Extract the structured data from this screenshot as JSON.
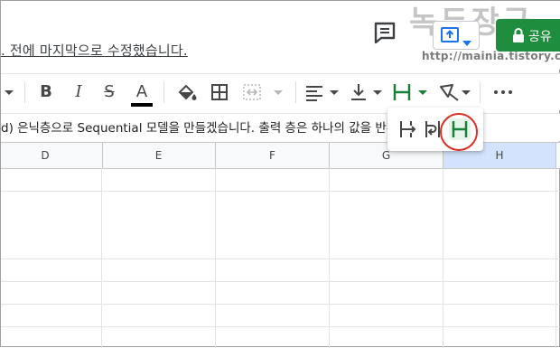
{
  "header": {
    "last_edit_text": ". 전에 마지막으로 수정했습니다.",
    "share_label": "공유",
    "watermark_title": "녹두장군",
    "watermark_url": "http://mainia.tistory.com"
  },
  "formula_bar": {
    "content": "d) 은닉층으로 Sequential 모델을 만들겠습니다. 출력 층은 하나의 값을 반환합"
  },
  "columns": [
    "D",
    "E",
    "F",
    "G",
    "H"
  ],
  "active_column": "H",
  "toolbar": {
    "bold_label": "B",
    "italic_label": "I",
    "strike_label": "S",
    "text_color_label": "A",
    "text_color": "#000000",
    "active_tool": "text-wrapping",
    "wrap_options": [
      "overflow",
      "wrap",
      "clip"
    ],
    "selected_wrap_option": "clip"
  },
  "colors": {
    "accent_green": "#1e8e3e",
    "highlight_red": "#d93025",
    "selection_blue": "#d3e3fd"
  }
}
